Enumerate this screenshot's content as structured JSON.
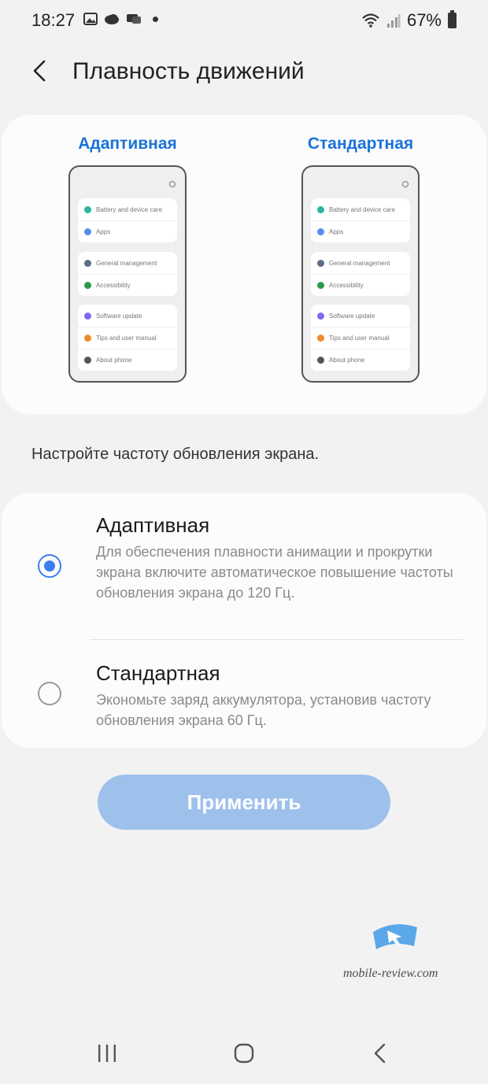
{
  "status_bar": {
    "time": "18:27",
    "left_icons": [
      "gallery-icon",
      "cloud-icon",
      "chat-icon"
    ],
    "battery": "67%"
  },
  "header": {
    "title": "Плавность движений"
  },
  "preview": {
    "left_label": "Адаптивная",
    "right_label": "Стандартная",
    "items": [
      {
        "label": "Battery and device care",
        "color": "#2bb5a0"
      },
      {
        "label": "Apps",
        "color": "#5a8cf0"
      },
      {
        "label": "General management",
        "color": "#5c6f86"
      },
      {
        "label": "Accessibility",
        "color": "#2e9a4a"
      },
      {
        "label": "Software update",
        "color": "#7b6cf0"
      },
      {
        "label": "Tips and user manual",
        "color": "#f08a2b"
      },
      {
        "label": "About phone",
        "color": "#555555"
      }
    ]
  },
  "subtitle": "Настройте частоту обновления экрана.",
  "options": [
    {
      "title": "Адаптивная",
      "description": "Для обеспечения плавности анимации и прокрутки экрана включите автоматическое повышение частоты обновления экрана до 120 Гц.",
      "selected": true
    },
    {
      "title": "Стандартная",
      "description": "Экономьте заряд аккумулятора, установив частоту обновления экрана 60 Гц.",
      "selected": false
    }
  ],
  "apply_label": "Применить",
  "watermark": "mobile-review.com",
  "colors": {
    "accent": "#3a7ef0",
    "label_blue": "#1a73d9",
    "apply_disabled": "#9ec1ec"
  }
}
